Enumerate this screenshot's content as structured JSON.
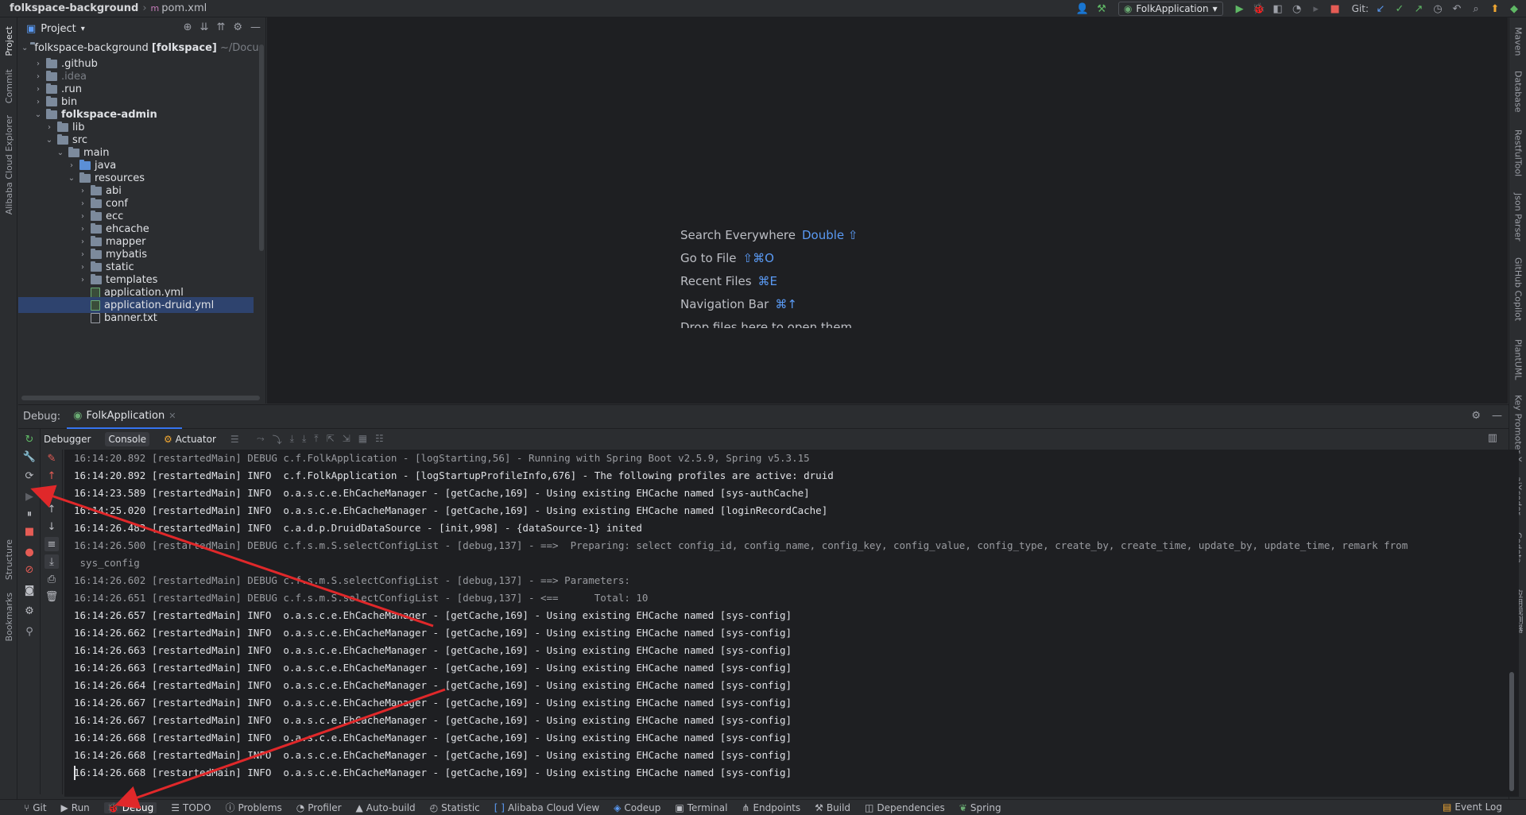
{
  "titlebar": {
    "project": "folkspace-background",
    "file": "pom.xml",
    "run_config": "FolkApplication",
    "git_label": "Git:"
  },
  "left_strip": [
    "Project",
    "Commit",
    "Alibaba Cloud Explorer",
    "Structure",
    "Bookmarks"
  ],
  "right_strip": [
    "Maven",
    "Database",
    "RestfulTool",
    "Json Parser",
    "GitHub Copilot",
    "PlantUML",
    "Key Promoter X",
    "aiXcoder",
    "Codota",
    "应用观测器"
  ],
  "project_panel": {
    "title": "Project",
    "rows": [
      {
        "label": "folkspace-background",
        "bold_suffix": "[folkspace]",
        "dim_suffix": "~/Docu"
      },
      {
        "label": ".github"
      },
      {
        "label": ".idea"
      },
      {
        "label": ".run"
      },
      {
        "label": "bin"
      },
      {
        "label": "folkspace-admin"
      },
      {
        "label": "lib"
      },
      {
        "label": "src"
      },
      {
        "label": "main"
      },
      {
        "label": "java"
      },
      {
        "label": "resources"
      },
      {
        "label": "abi"
      },
      {
        "label": "conf"
      },
      {
        "label": "ecc"
      },
      {
        "label": "ehcache"
      },
      {
        "label": "mapper"
      },
      {
        "label": "mybatis"
      },
      {
        "label": "static"
      },
      {
        "label": "templates"
      },
      {
        "label": "application.yml"
      },
      {
        "label": "application-druid.yml"
      },
      {
        "label": "banner.txt"
      }
    ]
  },
  "editor_hints": [
    {
      "label": "Search Everywhere",
      "key": "Double ⇧"
    },
    {
      "label": "Go to File",
      "key": "⇧⌘O"
    },
    {
      "label": "Recent Files",
      "key": "⌘E"
    },
    {
      "label": "Navigation Bar",
      "key": "⌘↑"
    },
    {
      "label": "Drop files here to open them",
      "key": ""
    }
  ],
  "debug": {
    "title": "Debug:",
    "tab": "FolkApplication",
    "subtabs": [
      "Debugger",
      "Console",
      "Actuator"
    ]
  },
  "console_lines": [
    {
      "text": "16:14:20.892 [restartedMain] DEBUG c.f.FolkApplication - [logStarting,56] - Running with Spring Boot v2.5.9, Spring v5.3.15",
      "level": "debug"
    },
    {
      "text": "16:14:20.892 [restartedMain] INFO  c.f.FolkApplication - [logStartupProfileInfo,676] - The following profiles are active: druid",
      "level": "info"
    },
    {
      "text": "16:14:23.589 [restartedMain] INFO  o.a.s.c.e.EhCacheManager - [getCache,169] - Using existing EHCache named [sys-authCache]",
      "level": "info"
    },
    {
      "text": "16:14:25.020 [restartedMain] INFO  o.a.s.c.e.EhCacheManager - [getCache,169] - Using existing EHCache named [loginRecordCache]",
      "level": "info"
    },
    {
      "text": "16:14:26.483 [restartedMain] INFO  c.a.d.p.DruidDataSource - [init,998] - {dataSource-1} inited",
      "level": "info"
    },
    {
      "text": "16:14:26.500 [restartedMain] DEBUG c.f.s.m.S.selectConfigList - [debug,137] - ==>  Preparing: select config_id, config_name, config_key, config_value, config_type, create_by, create_time, update_by, update_time, remark from",
      "level": "debug"
    },
    {
      "text": " sys_config",
      "level": "debug"
    },
    {
      "text": "16:14:26.602 [restartedMain] DEBUG c.f.s.m.S.selectConfigList - [debug,137] - ==> Parameters: ",
      "level": "debug"
    },
    {
      "text": "16:14:26.651 [restartedMain] DEBUG c.f.s.m.S.selectConfigList - [debug,137] - <==      Total: 10",
      "level": "debug"
    },
    {
      "text": "16:14:26.657 [restartedMain] INFO  o.a.s.c.e.EhCacheManager - [getCache,169] - Using existing EHCache named [sys-config]",
      "level": "info"
    },
    {
      "text": "16:14:26.662 [restartedMain] INFO  o.a.s.c.e.EhCacheManager - [getCache,169] - Using existing EHCache named [sys-config]",
      "level": "info"
    },
    {
      "text": "16:14:26.663 [restartedMain] INFO  o.a.s.c.e.EhCacheManager - [getCache,169] - Using existing EHCache named [sys-config]",
      "level": "info"
    },
    {
      "text": "16:14:26.663 [restartedMain] INFO  o.a.s.c.e.EhCacheManager - [getCache,169] - Using existing EHCache named [sys-config]",
      "level": "info"
    },
    {
      "text": "16:14:26.664 [restartedMain] INFO  o.a.s.c.e.EhCacheManager - [getCache,169] - Using existing EHCache named [sys-config]",
      "level": "info"
    },
    {
      "text": "16:14:26.667 [restartedMain] INFO  o.a.s.c.e.EhCacheManager - [getCache,169] - Using existing EHCache named [sys-config]",
      "level": "info"
    },
    {
      "text": "16:14:26.667 [restartedMain] INFO  o.a.s.c.e.EhCacheManager - [getCache,169] - Using existing EHCache named [sys-config]",
      "level": "info"
    },
    {
      "text": "16:14:26.668 [restartedMain] INFO  o.a.s.c.e.EhCacheManager - [getCache,169] - Using existing EHCache named [sys-config]",
      "level": "info"
    },
    {
      "text": "16:14:26.668 [restartedMain] INFO  o.a.s.c.e.EhCacheManager - [getCache,169] - Using existing EHCache named [sys-config]",
      "level": "info"
    },
    {
      "text": "16:14:26.668 [restartedMain] INFO  o.a.s.c.e.EhCacheManager - [getCache,169] - Using existing EHCache named [sys-config]",
      "level": "info"
    }
  ],
  "bottom_tabs": [
    "Git",
    "Run",
    "Debug",
    "TODO",
    "Problems",
    "Profiler",
    "Auto-build",
    "Statistic",
    "Alibaba Cloud View",
    "Codeup",
    "Terminal",
    "Endpoints",
    "Build",
    "Dependencies",
    "Spring"
  ],
  "event_log": "Event Log",
  "colors": {
    "accent": "#3574f0",
    "annotation": "#e0282a",
    "selection": "#2e436e"
  }
}
